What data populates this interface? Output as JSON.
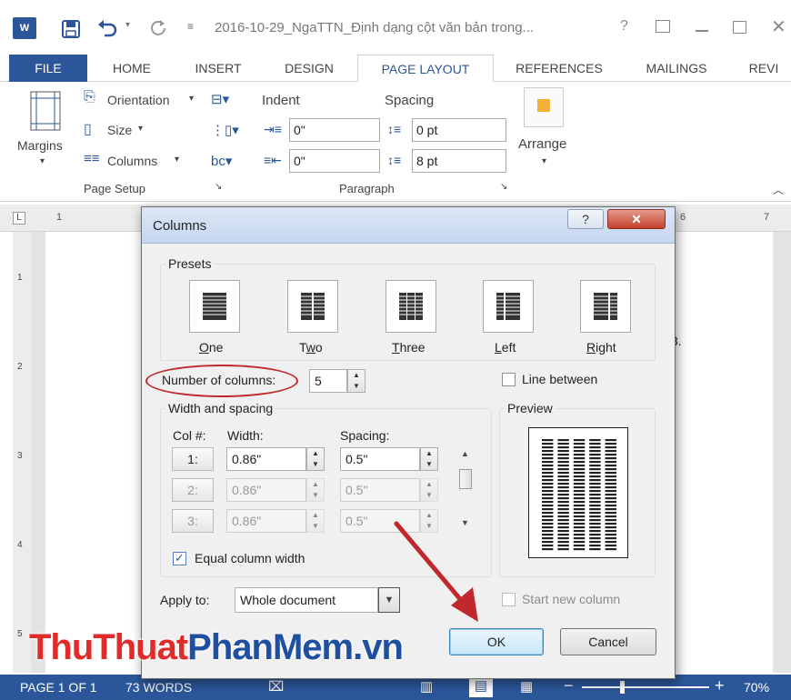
{
  "titlebar": {
    "doc_title": "2016-10-29_NgaTTN_Định dạng cột văn bản trong...",
    "help": "?"
  },
  "tabs": [
    "FILE",
    "HOME",
    "INSERT",
    "DESIGN",
    "PAGE LAYOUT",
    "REFERENCES",
    "MAILINGS",
    "REVI"
  ],
  "ribbon": {
    "orientation": "Orientation",
    "size": "Size",
    "columns": "Columns",
    "margins": "Margins",
    "indent": "Indent",
    "spacing": "Spacing",
    "indent_left": "0\"",
    "indent_right": "0\"",
    "spacing_before": "0 pt",
    "spacing_after": "8 pt",
    "arrange": "Arrange",
    "group_page_setup": "Page Setup",
    "group_paragraph": "Paragraph"
  },
  "ruler": {
    "left_mark": "1",
    "right_mark": "7",
    "right_num6": "6"
  },
  "vruler": {
    "marks": [
      "1",
      "2",
      "3",
      "4",
      "5"
    ]
  },
  "doc": {
    "text_fragment": "3."
  },
  "dialog": {
    "title": "Columns",
    "help": "?",
    "presets_label": "Presets",
    "presets": [
      {
        "label": "One",
        "u": "O",
        "rest": "ne"
      },
      {
        "label": "Two",
        "pre": "T",
        "u": "w",
        "rest": "o"
      },
      {
        "label": "Three",
        "u": "T",
        "rest": "hree"
      },
      {
        "label": "Left",
        "u": "L",
        "rest": "eft"
      },
      {
        "label": "Right",
        "u": "R",
        "rest": "ight"
      }
    ],
    "num_columns_label": "Number of columns:",
    "num_columns": "5",
    "line_between": "Line between",
    "width_spacing_label": "Width and spacing",
    "preview_label": "Preview",
    "col_header": "Col #:",
    "width_header": "Width:",
    "spacing_header": "Spacing:",
    "rows": [
      {
        "col": "1:",
        "width": "0.86\"",
        "spacing": "0.5\""
      },
      {
        "col": "2:",
        "width": "0.86\"",
        "spacing": "0.5\""
      },
      {
        "col": "3:",
        "width": "0.86\"",
        "spacing": "0.5\""
      }
    ],
    "equal_width": "Equal column width",
    "apply_to_label": "Apply to:",
    "apply_to_value": "Whole document",
    "start_new_column": "Start new column",
    "ok": "OK",
    "cancel": "Cancel"
  },
  "watermark": {
    "part1": "ThuThuat",
    "part2": "PhanMem",
    "part3": ".vn"
  },
  "status": {
    "page": "PAGE 1 OF 1",
    "words": "73 WORDS",
    "zoom": "70%"
  },
  "colors": {
    "word_blue": "#2b579a",
    "annot_red": "#c0282d",
    "watermark_red": "#e02b2b",
    "watermark_blue": "#1e4fa0"
  }
}
